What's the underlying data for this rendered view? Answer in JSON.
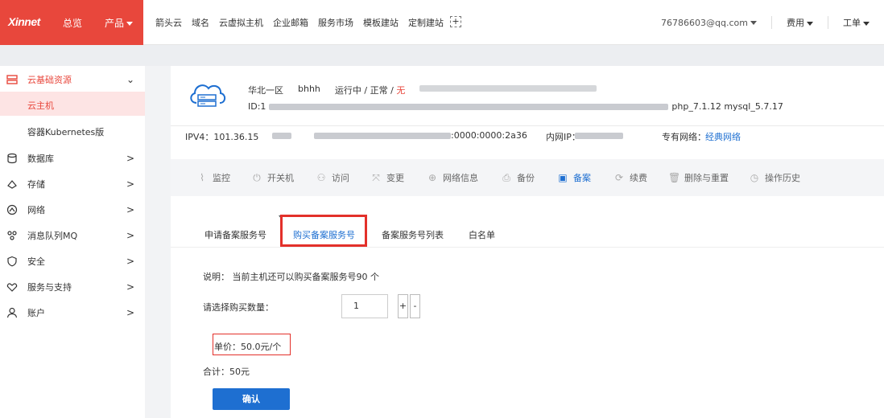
{
  "topbar": {
    "logo": "Xinnet",
    "overview": "总览",
    "products": "产品",
    "nav": [
      "箭头云",
      "域名",
      "云虚拟主机",
      "企业邮箱",
      "服务市场",
      "模板建站",
      "定制建站"
    ],
    "plus_symbol": "+",
    "account": "76786603@qq.com",
    "billing": "费用",
    "ticket": "工单"
  },
  "sidebar": {
    "group_label": "云基础资源",
    "sub_items": [
      "云主机",
      "容器Kubernetes版"
    ],
    "items": [
      {
        "label": "数据库",
        "icon": "database-icon"
      },
      {
        "label": "存储",
        "icon": "storage-icon"
      },
      {
        "label": "网络",
        "icon": "network-icon"
      },
      {
        "label": "消息队列MQ",
        "icon": "mq-icon"
      },
      {
        "label": "安全",
        "icon": "shield-icon"
      },
      {
        "label": "服务与支持",
        "icon": "support-icon"
      },
      {
        "label": "账户",
        "icon": "user-icon"
      }
    ]
  },
  "host": {
    "region": "华北一区",
    "name": "bhhh",
    "status_prefix": "运行中 / 正常 / ",
    "status_flag": "无",
    "id_prefix": "ID:1",
    "env_suffix": "php_7.1.12 mysql_5.7.17",
    "ipv4": "IPV4：101.36.15",
    "ipv6_suffix": ":0000:0000:2a36",
    "private_ip_label": "内网IP：",
    "vpc_label": "专有网络：",
    "vpc_value": "经典网络"
  },
  "toolbar": [
    {
      "label": "监控",
      "icon": "monitor-icon"
    },
    {
      "label": "开关机",
      "icon": "power-icon"
    },
    {
      "label": "访问",
      "icon": "access-icon"
    },
    {
      "label": "变更",
      "icon": "change-icon"
    },
    {
      "label": "网络信息",
      "icon": "globe-icon"
    },
    {
      "label": "备份",
      "icon": "backup-icon"
    },
    {
      "label": "备案",
      "icon": "record-icon"
    },
    {
      "label": "续费",
      "icon": "renew-icon"
    },
    {
      "label": "删除与重置",
      "icon": "trash-icon"
    },
    {
      "label": "操作历史",
      "icon": "history-icon"
    }
  ],
  "tabs": [
    "申请备案服务号",
    "购买备案服务号",
    "备案服务号列表",
    "白名单"
  ],
  "form": {
    "description": "说明：  当前主机还可以购买备案服务号90 个",
    "quantity_label": "请选择购买数量：",
    "quantity_value": "1",
    "plus": "+",
    "minus": "-",
    "unit_price": "单价：50.0元/个",
    "total": "合计：50元",
    "confirm": "确认"
  },
  "colors": {
    "brand": "#e8473c",
    "primary": "#1e6fd1",
    "highlight": "#e3302a"
  }
}
